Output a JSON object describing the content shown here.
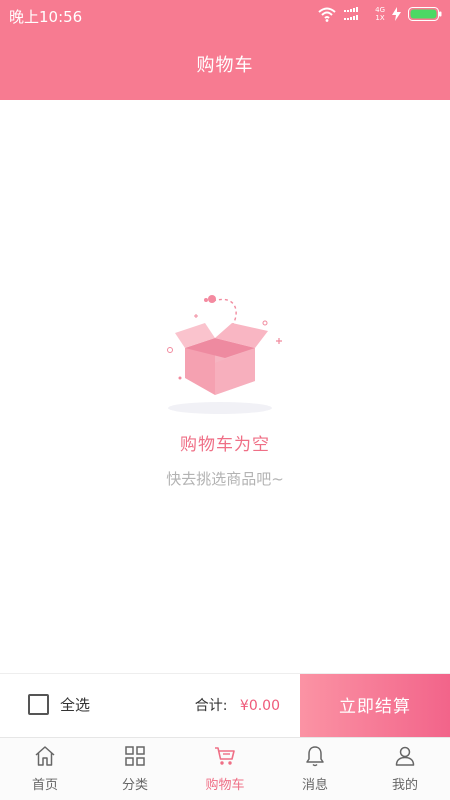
{
  "status_bar": {
    "time": "晚上10:56",
    "network_top": "4G",
    "network_bottom": "1X",
    "icons": [
      "wifi-icon",
      "signal-icon",
      "charging-icon",
      "battery-icon"
    ]
  },
  "header": {
    "title": "购物车"
  },
  "empty_state": {
    "title": "购物车为空",
    "subtitle": "快去挑选商品吧~",
    "illustration": "open-box-icon"
  },
  "checkout_bar": {
    "select_all_label": "全选",
    "select_all_checked": false,
    "total_label": "合计:",
    "total_value": "¥0.00",
    "checkout_label": "立即结算"
  },
  "tabbar": {
    "active": "购物车",
    "items": [
      {
        "label": "首页",
        "icon": "home-icon"
      },
      {
        "label": "分类",
        "icon": "grid-icon"
      },
      {
        "label": "购物车",
        "icon": "cart-icon"
      },
      {
        "label": "消息",
        "icon": "bell-icon"
      },
      {
        "label": "我的",
        "icon": "user-icon"
      }
    ]
  },
  "colors": {
    "primary": "#f77b91",
    "accent_text": "#ef6f86",
    "price": "#ef5a7a",
    "muted_text": "#b3b3b3"
  }
}
